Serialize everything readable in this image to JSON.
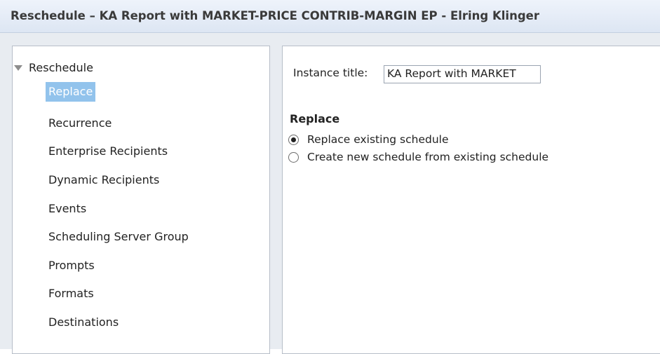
{
  "window": {
    "title": "Reschedule – KA Report with MARKET-PRICE CONTRIB-MARGIN EP - Elring Klinger"
  },
  "nav": {
    "root_label": "Reschedule",
    "items": [
      {
        "label": "Replace",
        "selected": true
      },
      {
        "label": "Recurrence"
      },
      {
        "label": "Enterprise Recipients"
      },
      {
        "label": "Dynamic Recipients"
      },
      {
        "label": "Events"
      },
      {
        "label": "Scheduling Server Group"
      },
      {
        "label": "Prompts"
      },
      {
        "label": "Formats"
      },
      {
        "label": "Destinations"
      }
    ]
  },
  "form": {
    "instance_title_label": "Instance title:",
    "instance_title_value": "KA Report with MARKET",
    "section_heading": "Replace",
    "options": [
      {
        "label": "Replace existing schedule",
        "checked": true
      },
      {
        "label": "Create new schedule from existing schedule",
        "checked": false
      }
    ]
  },
  "colors": {
    "selected_bg": "#92c3ec",
    "titlebar_bg": "#dde6f3"
  }
}
